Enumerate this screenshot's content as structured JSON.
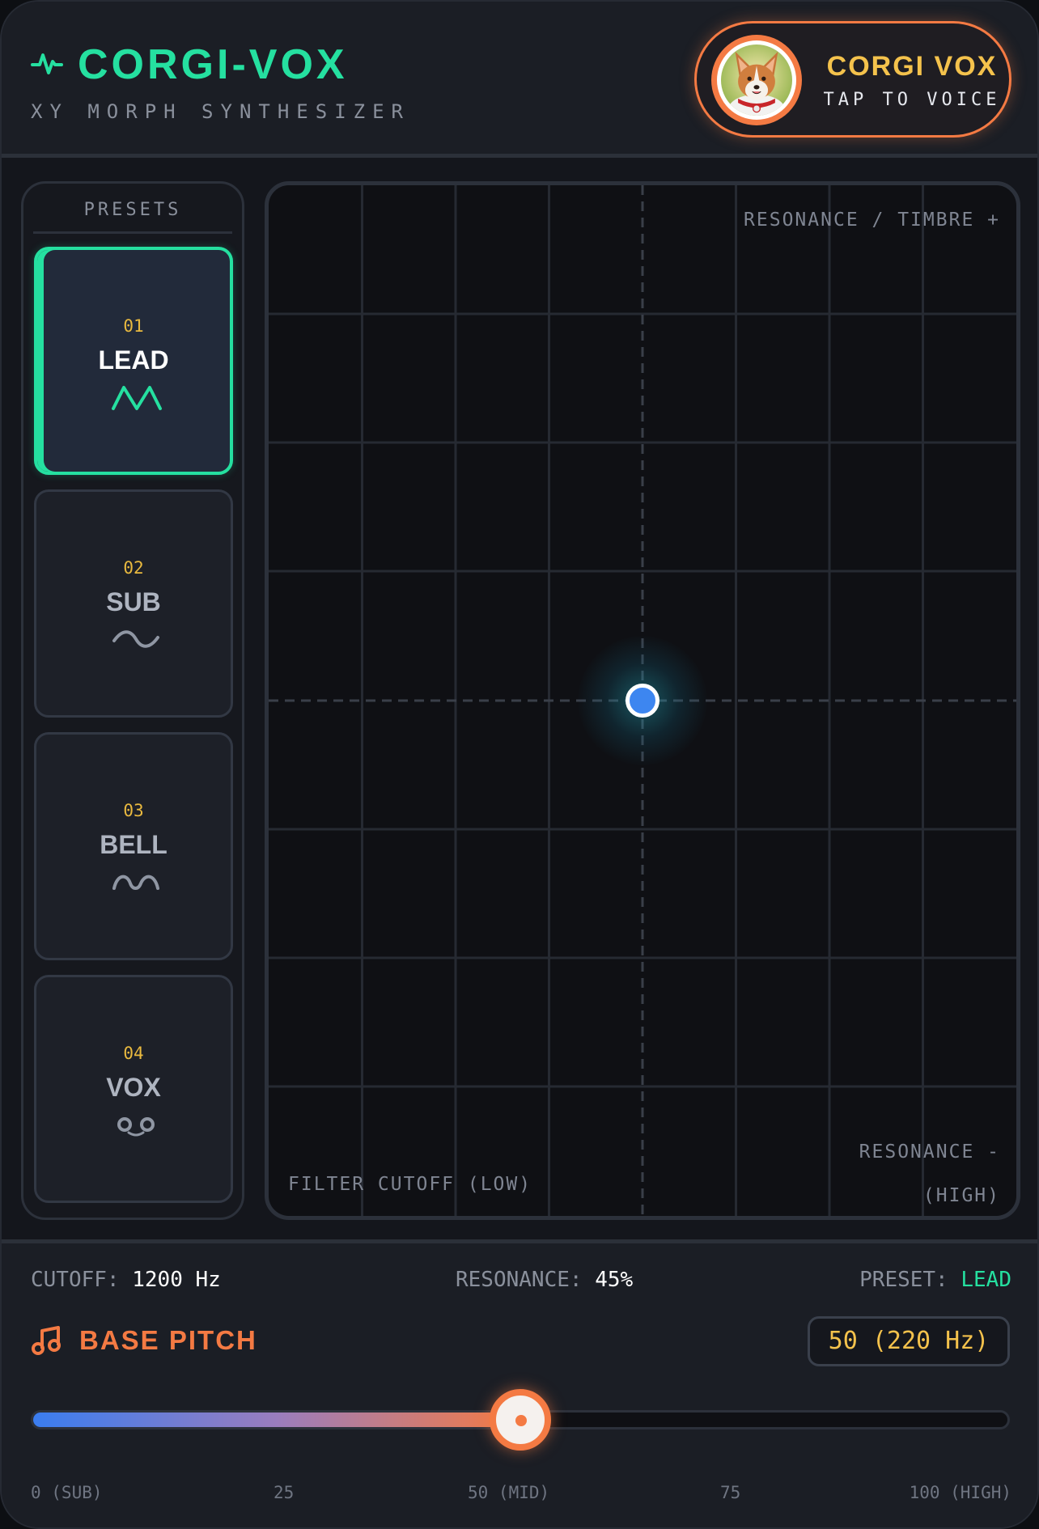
{
  "header": {
    "title": "CORGI-VOX",
    "subtitle": "XY MORPH SYNTHESIZER",
    "icon": "activity-pulse-icon",
    "voice_button": {
      "title": "CORGI VOX",
      "subtitle": "TAP TO VOICE",
      "avatar": "corgi-avatar"
    }
  },
  "presets": {
    "title": "PRESETS",
    "items": [
      {
        "num": "01",
        "name": "LEAD",
        "icon": "triangle-wave-icon",
        "active": true
      },
      {
        "num": "02",
        "name": "SUB",
        "icon": "sine-wave-icon",
        "active": false
      },
      {
        "num": "03",
        "name": "BELL",
        "icon": "bell-wave-icon",
        "active": false
      },
      {
        "num": "04",
        "name": "VOX",
        "icon": "vox-circles-icon",
        "active": false
      }
    ]
  },
  "xy_pad": {
    "label_top_right": "RESONANCE / TIMBRE +",
    "label_bottom_right_1": "RESONANCE -",
    "label_bottom_right_2": "(HIGH)",
    "label_bottom_left": "FILTER CUTOFF (LOW)",
    "handle_x": 0.5,
    "handle_y": 0.5
  },
  "readouts": {
    "cutoff_label": "CUTOFF:",
    "cutoff_value": "1200 Hz",
    "resonance_label": "RESONANCE:",
    "resonance_value": "45%",
    "preset_label": "PRESET:",
    "preset_value": "LEAD"
  },
  "pitch": {
    "label": "BASE PITCH",
    "icon": "music-note-icon",
    "value_display": "50 (220 Hz)",
    "value": 50,
    "min": 0,
    "max": 100,
    "ticks": [
      "0 (SUB)",
      "25",
      "50 (MID)",
      "75",
      "100 (HIGH)"
    ]
  },
  "colors": {
    "accent_green": "#25e0a0",
    "accent_orange": "#f47a43",
    "accent_yellow": "#f4c24c",
    "handle_blue": "#3d86f0"
  }
}
